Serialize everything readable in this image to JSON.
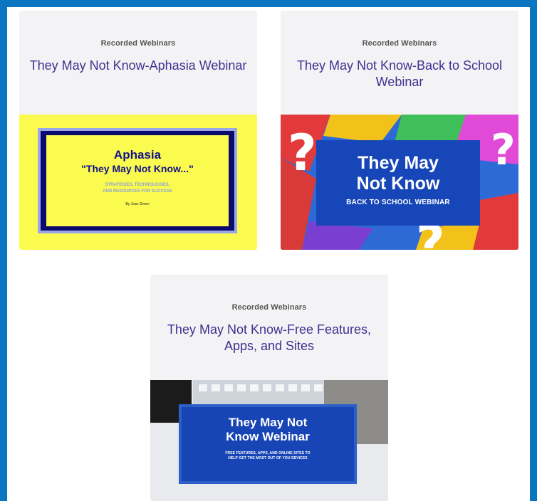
{
  "cards": [
    {
      "category": "Recorded Webinars",
      "title": "They May Not Know-Aphasia Webinar",
      "thumb": {
        "heading": "Aphasia",
        "subheading": "\"They May Not Know...\"",
        "small_line1": "STRATEGIES, TECHNOLOGIES,",
        "small_line2": "AND RESOURCES FOR SUCCESS",
        "byline": "By Joan Green"
      }
    },
    {
      "category": "Recorded Webinars",
      "title": "They May Not Know-Back to School Webinar",
      "thumb": {
        "heading_line1": "They May",
        "heading_line2": "Not Know",
        "subheading": "BACK TO SCHOOL WEBINAR"
      }
    },
    {
      "category": "Recorded Webinars",
      "title": "They May Not Know-Free Features, Apps, and Sites",
      "thumb": {
        "heading_line1": "They May Not",
        "heading_line2": "Know Webinar",
        "small_line1": "FREE FEATURES, APPS, AND ONLINE SITES TO",
        "small_line2": "HELP GET THE MOST OUT OF YOU DEVICES"
      }
    }
  ],
  "colors": {
    "frame": "#0a76c2",
    "card_bg": "#f3f3f5",
    "title": "#3c3190",
    "yellow": "#fbfb4f",
    "blue_box": "#1746b8"
  }
}
